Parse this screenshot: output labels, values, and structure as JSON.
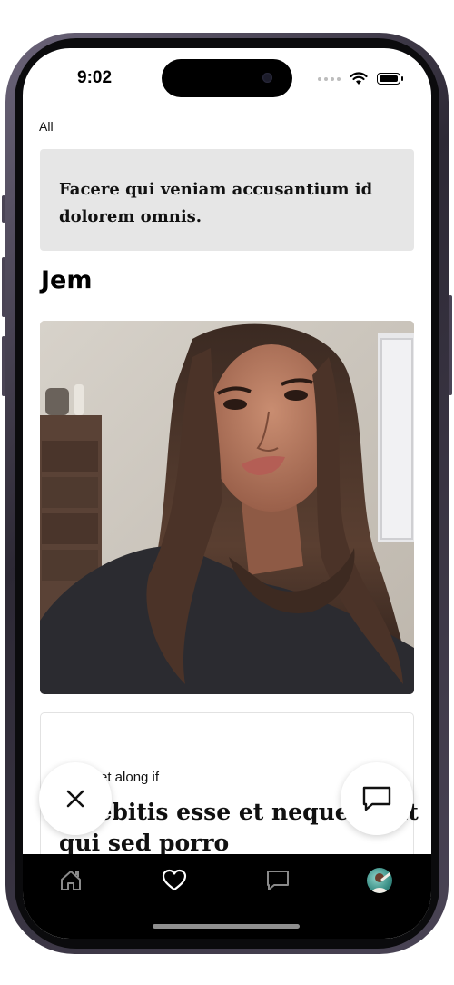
{
  "status_bar": {
    "time": "9:02"
  },
  "filter": {
    "label": "All"
  },
  "prompt_card": {
    "text": "Facere qui veniam accusantium id dolorem omnis."
  },
  "profile": {
    "name": "Jem"
  },
  "answer_card": {
    "label": "…et along if",
    "text": "…debitis esse et neque fugit qui sed porro"
  },
  "actions": {
    "dismiss_icon": "close-icon",
    "comment_icon": "chat-bubble-icon"
  },
  "tab_bar": {
    "items": [
      {
        "icon": "home-icon"
      },
      {
        "icon": "heart-icon"
      },
      {
        "icon": "chat-icon"
      },
      {
        "icon": "avatar"
      }
    ]
  },
  "colors": {
    "prompt_card_bg": "#e6e6e6",
    "tab_bar_bg": "#000000",
    "text_primary": "#111111"
  }
}
